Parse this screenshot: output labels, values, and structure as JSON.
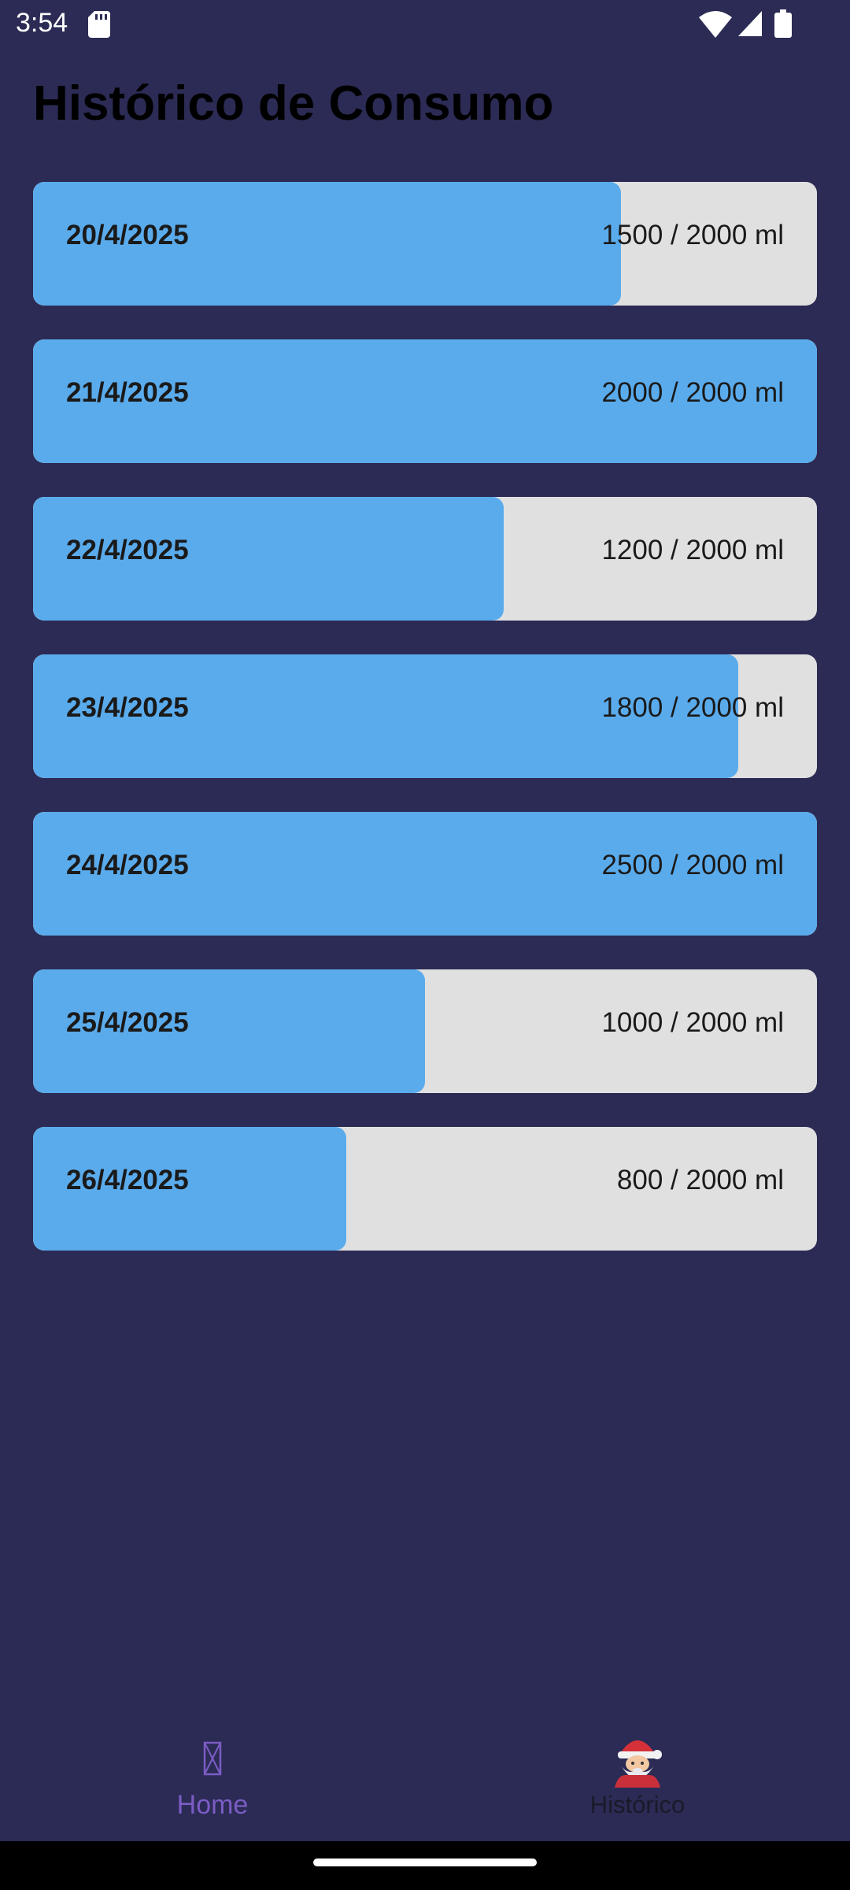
{
  "status_bar": {
    "time": "3:54",
    "icons": [
      "sd-card-icon",
      "wifi-icon",
      "signal-icon",
      "battery-icon"
    ]
  },
  "page": {
    "title": "Histórico de Consumo"
  },
  "history": [
    {
      "date": "20/4/2025",
      "amount": "1500 / 2000 ml",
      "progress": 0.75
    },
    {
      "date": "21/4/2025",
      "amount": "2000 / 2000 ml",
      "progress": 1.0
    },
    {
      "date": "22/4/2025",
      "amount": "1200 / 2000 ml",
      "progress": 0.6
    },
    {
      "date": "23/4/2025",
      "amount": "1800 / 2000 ml",
      "progress": 0.9
    },
    {
      "date": "24/4/2025",
      "amount": "2500 / 2000 ml",
      "progress": 1.0
    },
    {
      "date": "25/4/2025",
      "amount": "1000 / 2000 ml",
      "progress": 0.5
    },
    {
      "date": "26/4/2025",
      "amount": "800 / 2000 ml",
      "progress": 0.4
    }
  ],
  "bottom_nav": {
    "items": [
      {
        "label": "Home",
        "icon": "missing-glyph-icon",
        "active": true
      },
      {
        "label": "Histórico",
        "icon": "santa-icon",
        "active": false
      }
    ]
  },
  "colors": {
    "background": "#2b2b55",
    "progress_fill": "#5aabec",
    "progress_track": "#e0e0e0",
    "active_nav": "#7b5cc4"
  }
}
